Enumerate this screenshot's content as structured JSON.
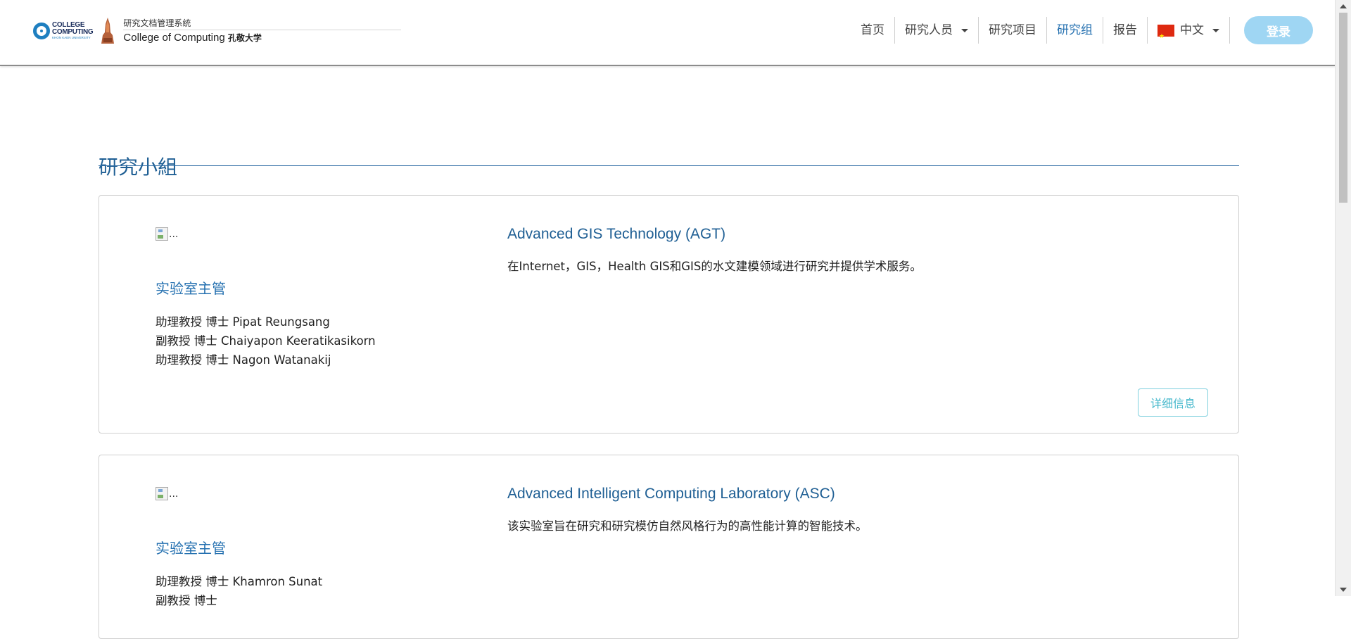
{
  "header": {
    "logo_college_line1": "COLLEGE",
    "logo_college_line2": "COMPUTING",
    "logo_university": "KHON KAEN UNIVERSITY",
    "system_name": "研究文档管理系统",
    "college_name": "College of Computing",
    "university_name": "孔敬大学"
  },
  "nav": {
    "home": "首页",
    "researchers": "研究人员",
    "projects": "研究项目",
    "groups": "研究组",
    "reports": "报告",
    "language": "中文",
    "login": "登录"
  },
  "page": {
    "title": "研究小組"
  },
  "groups": [
    {
      "image_alt": "...",
      "lab_head_label": "实验室主管",
      "members": [
        "助理教授 博士 Pipat Reungsang",
        "副教授 博士 Chaiyapon Keeratikasikorn",
        "助理教授 博士 Nagon Watanakij"
      ],
      "name": "Advanced GIS Technology (AGT)",
      "description": "在Internet，GIS，Health GIS和GIS的水文建模领域进行研究并提供学术服务。",
      "detail_button": "详细信息"
    },
    {
      "image_alt": "...",
      "lab_head_label": "实验室主管",
      "members": [
        "助理教授 博士 Khamron Sunat",
        "副教授 博士"
      ],
      "name": "Advanced Intelligent Computing Laboratory (ASC)",
      "description": "该实验室旨在研究和研究模仿自然风格行为的高性能计算的智能技术。"
    }
  ],
  "colors": {
    "accent": "#2470b0",
    "title": "#1f5f94",
    "login_bg": "#9fd6f3",
    "detail_border": "#7fd0de"
  }
}
